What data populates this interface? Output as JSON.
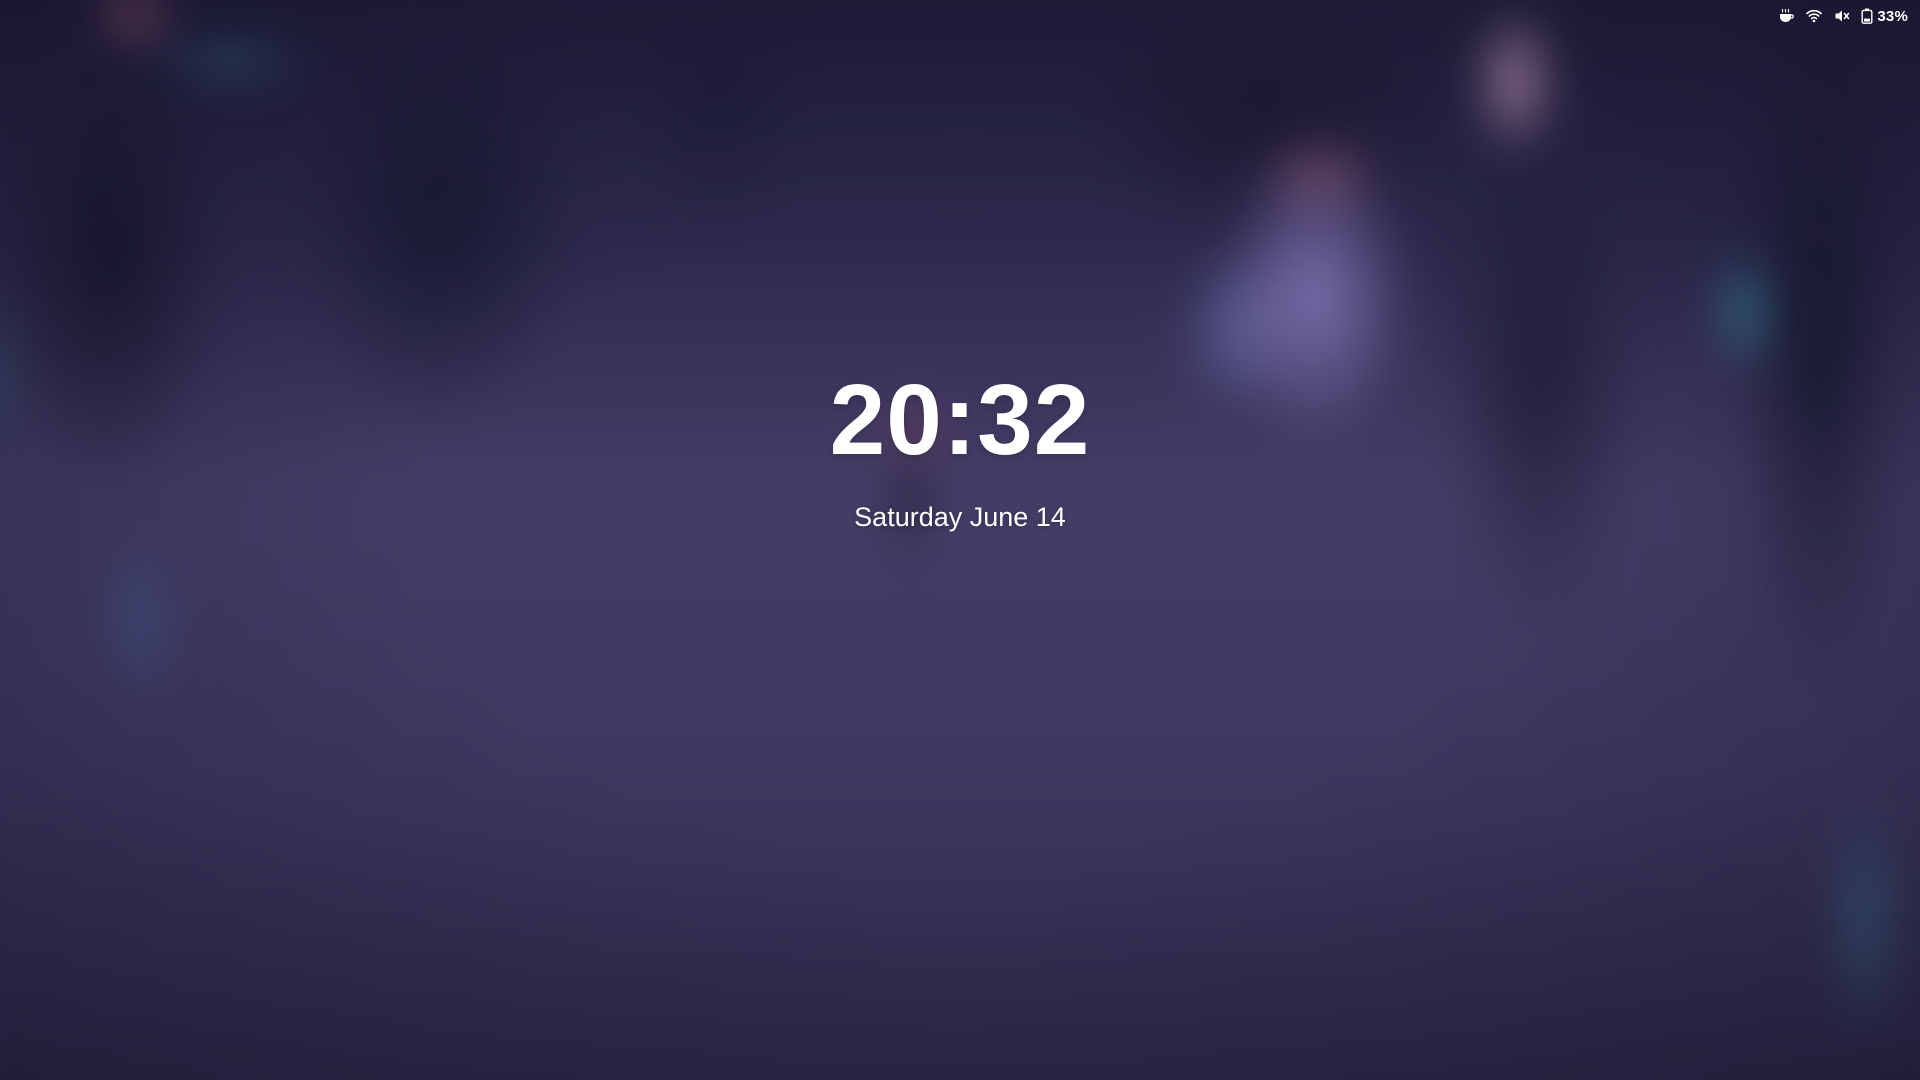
{
  "lock_screen": {
    "time": "20:32",
    "date": "Saturday June 14"
  },
  "status_bar": {
    "indicators": [
      {
        "icon": "coffee-cup-icon",
        "meaning": "caffeine"
      },
      {
        "icon": "wifi-icon"
      },
      {
        "icon": "volume-muted-icon"
      },
      {
        "icon": "battery-icon"
      }
    ],
    "battery_percent": "33%"
  },
  "colors": {
    "text": "#ffffff",
    "background_tint": "#3b3556"
  }
}
